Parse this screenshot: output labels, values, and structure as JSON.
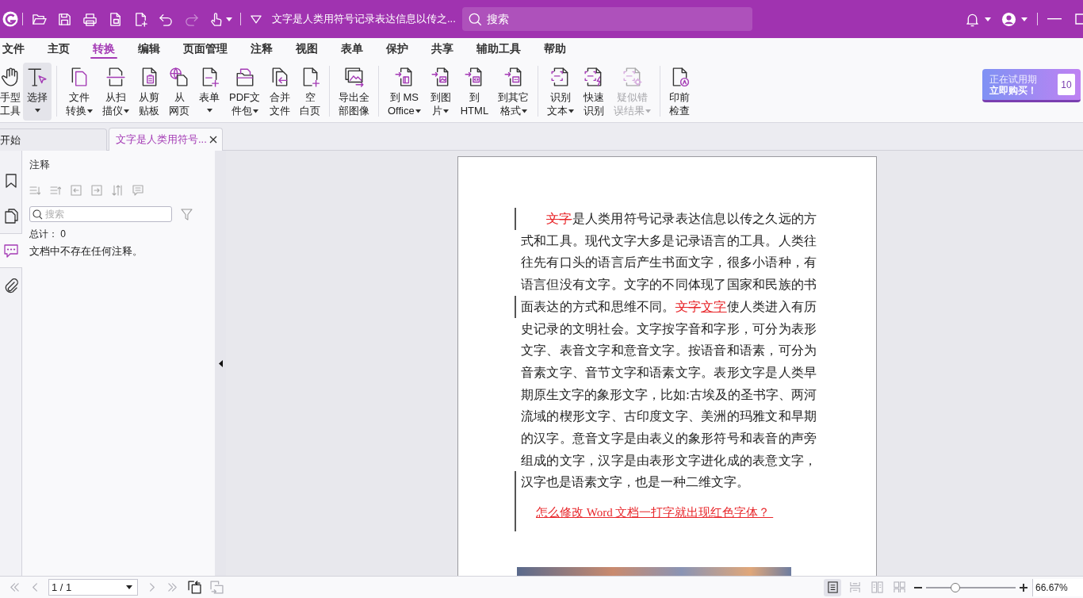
{
  "title_bar": {
    "quick_access": [
      {
        "disabled": false,
        "dropdown": false
      },
      {
        "disabled": false,
        "dropdown": false
      },
      {
        "disabled": false,
        "dropdown": false
      },
      {
        "disabled": false,
        "dropdown": false
      },
      {
        "disabled": false,
        "dropdown": false
      },
      {
        "disabled": false,
        "dropdown": false
      },
      {
        "disabled": true,
        "dropdown": false
      },
      {
        "disabled": false,
        "dropdown": true
      }
    ],
    "document_title": "文字是人类用符号记录表达信息以传之...",
    "search": {
      "placeholder": "搜索"
    }
  },
  "menu": [
    {
      "label": "文件",
      "selected": false
    },
    {
      "label": "主页",
      "selected": false
    },
    {
      "label": "转换",
      "selected": true
    },
    {
      "label": "编辑",
      "selected": false
    },
    {
      "label": "页面管理",
      "selected": false
    },
    {
      "label": "注释",
      "selected": false
    },
    {
      "label": "视图",
      "selected": false
    },
    {
      "label": "表单",
      "selected": false
    },
    {
      "label": "保护",
      "selected": false
    },
    {
      "label": "共享",
      "selected": false
    },
    {
      "label": "辅助工具",
      "selected": false
    },
    {
      "label": "帮助",
      "selected": false
    }
  ],
  "ribbon": {
    "groups": [
      {
        "tools": [
          {
            "lines": [
              "手型",
              "工具"
            ],
            "dropdown": false,
            "selected": false,
            "disabled": false
          },
          {
            "lines": [
              "选择"
            ],
            "dropdown": true,
            "selected": true,
            "disabled": false
          }
        ]
      },
      {
        "tools": [
          {
            "lines": [
              "文件",
              "转换"
            ],
            "dropdown": true,
            "selected": false,
            "disabled": false
          },
          {
            "lines": [
              "从扫",
              "描仪"
            ],
            "dropdown": true,
            "selected": false,
            "disabled": false
          },
          {
            "lines": [
              "从剪",
              "贴板"
            ],
            "dropdown": false,
            "selected": false,
            "disabled": false
          },
          {
            "lines": [
              "从",
              "网页"
            ],
            "dropdown": false,
            "selected": false,
            "disabled": false
          },
          {
            "lines": [
              "表单"
            ],
            "dropdown": true,
            "selected": false,
            "disabled": false
          },
          {
            "lines": [
              "PDF文",
              "件包"
            ],
            "dropdown": true,
            "selected": false,
            "disabled": false
          },
          {
            "lines": [
              "合并",
              "文件"
            ],
            "dropdown": false,
            "selected": false,
            "disabled": false
          },
          {
            "lines": [
              "空",
              "白页"
            ],
            "dropdown": false,
            "selected": false,
            "disabled": false
          }
        ]
      },
      {
        "tools": [
          {
            "lines": [
              "导出全",
              "部图像"
            ],
            "dropdown": false,
            "selected": false,
            "disabled": false
          }
        ]
      },
      {
        "tools": [
          {
            "lines": [
              "到 MS",
              "Office"
            ],
            "dropdown": true,
            "selected": false,
            "disabled": false
          },
          {
            "lines": [
              "到图",
              "片"
            ],
            "dropdown": true,
            "selected": false,
            "disabled": false
          },
          {
            "lines": [
              "到",
              "HTML"
            ],
            "dropdown": false,
            "selected": false,
            "disabled": false
          },
          {
            "lines": [
              "到其它",
              "格式"
            ],
            "dropdown": true,
            "selected": false,
            "disabled": false
          }
        ]
      },
      {
        "tools": [
          {
            "lines": [
              "识别",
              "文本"
            ],
            "dropdown": true,
            "selected": false,
            "disabled": false
          },
          {
            "lines": [
              "快速",
              "识别"
            ],
            "dropdown": false,
            "selected": false,
            "disabled": false
          },
          {
            "lines": [
              "疑似错",
              "误结果"
            ],
            "dropdown": true,
            "selected": false,
            "disabled": true
          }
        ]
      },
      {
        "tools": [
          {
            "lines": [
              "印前",
              "检查"
            ],
            "dropdown": false,
            "selected": false,
            "disabled": false
          }
        ]
      }
    ]
  },
  "trial": {
    "lines": [
      "正在试用期",
      "立即购买！"
    ],
    "days": "10"
  },
  "tabs": [
    {
      "label": "开始",
      "selected": false,
      "closable": false
    },
    {
      "label": "文字是人类用符号...",
      "selected": true,
      "closable": true
    }
  ],
  "side_rail": [
    {
      "selected": false
    },
    {
      "selected": false
    },
    {
      "selected": true
    },
    {
      "selected": false
    }
  ],
  "annotations_panel": {
    "title": "注释",
    "tools": [
      {
        "disabled": true
      },
      {
        "disabled": true
      },
      {
        "disabled": true
      },
      {
        "disabled": true
      },
      {
        "disabled": true
      },
      {
        "disabled": true
      }
    ],
    "search": {
      "placeholder": "搜索"
    },
    "total_label": "总计：",
    "total": "0",
    "empty_message": "文档中不存在任何注释。"
  },
  "document": {
    "paragraphs": [
      {
        "kind": "body",
        "segments": [
          {
            "kind": "deleted",
            "text": "文字"
          },
          {
            "kind": "normal",
            "text": "是人类用符号记录表达信息以传之久远的方式和工具。现代文字大多是记录语言的工具。人类往往先有口头的语言后产生书面文字，很多小语种，有语言但没有文字。文字的不同体现了国家和民族的书面表达的方式和思维不同。"
          },
          {
            "kind": "deleted",
            "text": "文字"
          },
          {
            "kind": "inserted",
            "text": "文字"
          },
          {
            "kind": "normal",
            "text": "使人类进入有历史记录的文明社会。文字按字音和字形，可分为表形文字、表音文字和意音文字。按语音和语素，可分为音素文字、音节文字和语素文字。 表形文字是人类早期原生文字的象形文字，比如:古埃及的圣书字、两河流域的楔形文字、古印度文字、美洲的玛雅文和早期的汉字。意音文字是由表义的象形符号和表音的声旁组成的文字，汉字是由表形文字进化成的表意文字，汉字也是语素文字，也是一种二维文字。"
          }
        ]
      },
      {
        "kind": "inserted",
        "segments": [
          {
            "kind": "inserted",
            "text": "怎么修改 Word 文档一打字就出现红色字体？ "
          }
        ]
      }
    ]
  },
  "status_bar": {
    "navigation": [
      {
        "disabled": true
      },
      {
        "disabled": true
      },
      {
        "disabled": true
      },
      {
        "disabled": true
      }
    ],
    "page": "1 / 1",
    "page_tools": [
      {
        "disabled": false
      },
      {
        "disabled": true
      }
    ],
    "view_modes": [
      {
        "selected": true
      },
      {
        "selected": false
      },
      {
        "selected": false
      },
      {
        "selected": false
      }
    ],
    "zoom": {
      "level": 0.33,
      "value": "66.67%"
    }
  }
}
